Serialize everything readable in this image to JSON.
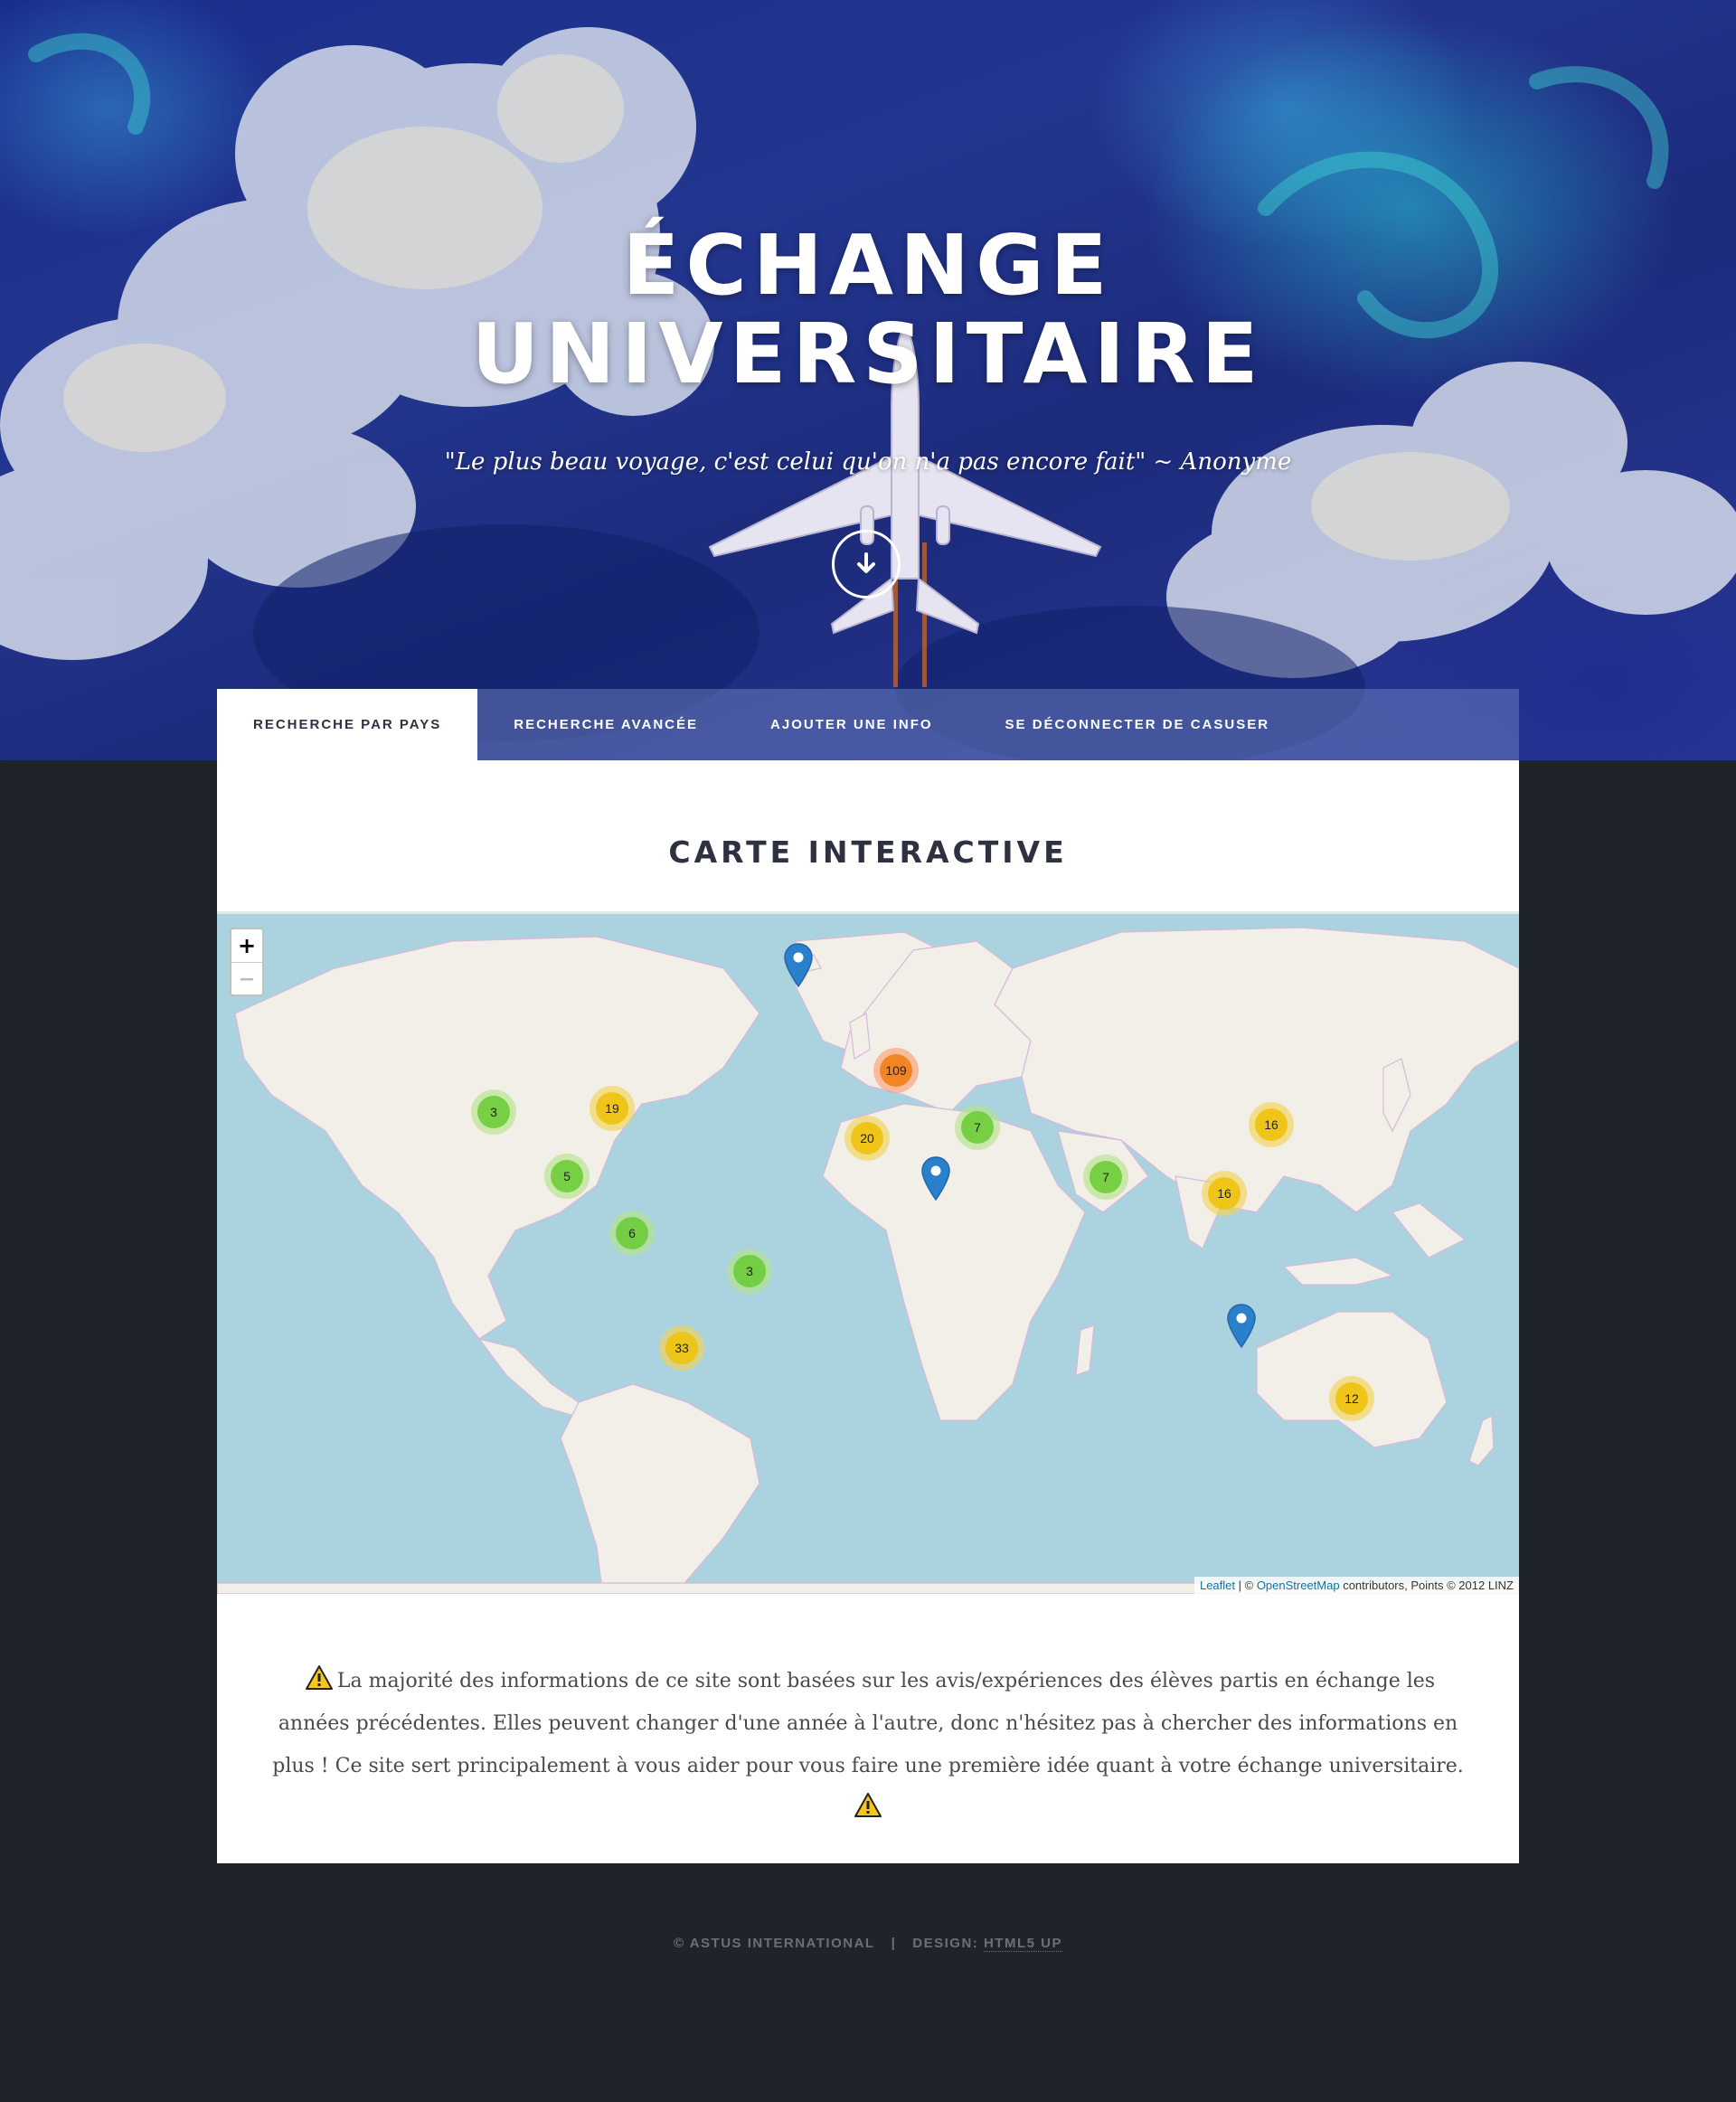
{
  "hero": {
    "title_line1": "ÉCHANGE",
    "title_line2": "UNIVERSITAIRE",
    "quote": "\"Le plus beau voyage, c'est celui qu'on n'a pas encore fait\" ~ Anonyme",
    "scroll_icon": "arrow-down-icon"
  },
  "nav": {
    "items": [
      {
        "label": "Recherche par pays",
        "active": true
      },
      {
        "label": "Recherche avancée",
        "active": false
      },
      {
        "label": "Ajouter une info",
        "active": false
      },
      {
        "label": "Se déconnecter de CASUSER",
        "active": false
      }
    ]
  },
  "main": {
    "title": "CARTE INTERACTIVE",
    "map": {
      "zoom_in": "+",
      "zoom_out": "−",
      "clusters": [
        {
          "count": "109",
          "size": "large"
        },
        {
          "count": "3",
          "size": "small"
        },
        {
          "count": "19",
          "size": "medium"
        },
        {
          "count": "5",
          "size": "small"
        },
        {
          "count": "6",
          "size": "small"
        },
        {
          "count": "3",
          "size": "small"
        },
        {
          "count": "33",
          "size": "medium"
        },
        {
          "count": "20",
          "size": "medium"
        },
        {
          "count": "7",
          "size": "small"
        },
        {
          "count": "7",
          "size": "small"
        },
        {
          "count": "16",
          "size": "medium"
        },
        {
          "count": "16",
          "size": "medium"
        },
        {
          "count": "12",
          "size": "medium"
        }
      ],
      "attribution": {
        "leaflet": "Leaflet",
        "sep": " | © ",
        "osm": "OpenStreetMap",
        "rest": " contributors, Points © 2012 LINZ"
      }
    },
    "notice": {
      "text": "La majorité des informations de ce site sont basées sur les avis/expériences des élèves partis en échange les années précédentes. Elles peuvent changer d'une année à l'autre, donc n'hésitez pas à chercher des informations en plus ! Ce site sert principalement à vous aider pour vous faire une première idée quant à votre échange universitaire."
    }
  },
  "footer": {
    "copyright": "© ASTUS INTERNATIONAL",
    "separator": "|",
    "design_label": "DESIGN: ",
    "design_link": "HTML5 UP"
  },
  "colors": {
    "page_bg": "#1f232a",
    "nav_active_text": "#2e3141",
    "map_water": "#aad3df",
    "map_land": "#f2efe9",
    "marker_blue": "#2a81cb"
  }
}
